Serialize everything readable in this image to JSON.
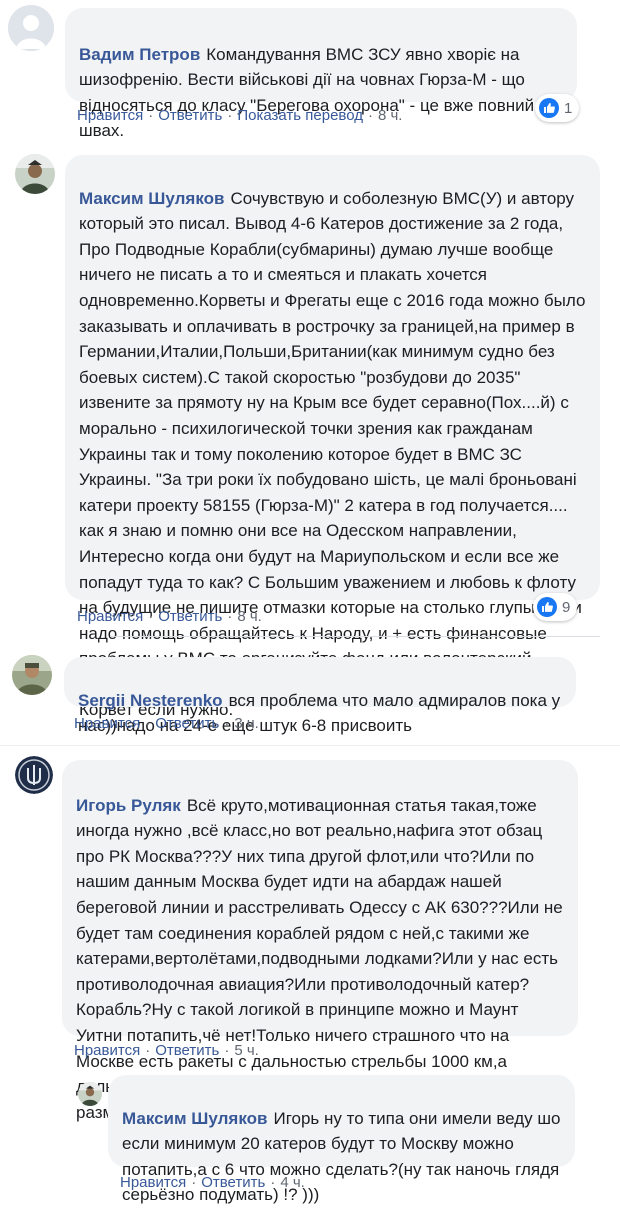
{
  "actions": {
    "like": "Нравится",
    "reply": "Ответить",
    "translate": "Показать перевод",
    "separator": "·"
  },
  "comments": [
    {
      "author": "Вадим Петров",
      "text": "Командування ВМС ЗСУ явно хворіє на шизофренію. Вести військові дії на човнах Гюрза-М - що відносяться до класу \"Берегова охорона\" - це вже повний швах.",
      "time": "8 ч.",
      "reactions": "1"
    },
    {
      "author": "Максим Шуляков",
      "text": "Сочувствую и соболезную ВМС(У) и автору который это писал. Вывод 4-6 Катеров достижение за 2 года, Про Подводные Корабли(субмарины) думаю лучше вообще ничего не писать а то и смеяться и плакать хочется одновременно.Корветы и Фрегаты еще с 2016 года можно было заказывать и оплачивать в рострочку за границей,на пример в Германии,Италии,Польши,Британии(как минимум судно без боевых систем).С такой скоростью \"розбудови до 2035\" извените за прямоту ну на Крым все будет серавно(Пох....й) с морально - психилогической точки зрения как гражданам Украины так и тому поколению которое будет в ВМС ЗС Украины. \"За три роки їх побудовано шість, це малі броньовані катери проекту 58155 (Гюрза-М)\" 2 катера в год получается.... как я знаю и помню они все на Одесском направлении, Интересно когда они будут на Мариупольском и если все же попадут туда то как? С Большим уважением и любовь к флоту на будущие не пишите отмазки которые на столько глупы, если надо помощь обращайтесь к Народу, и + есть финансовые проблемы у ВМС то организуйте фонд или волонтерский сбор(как называтся будет людям пофиг) вам помогут да же на Корвет если нужно.",
      "time": "8 ч.",
      "reactions": "9"
    },
    {
      "author": "Sergii Nesterenko",
      "text": "вся проблема что мало адмиралов пока у нас))надо на 24-е еще штук 6-8 присвоить",
      "time": "3 ч."
    },
    {
      "author": "Игорь Руляк",
      "text": "Всё круто,мотивационная статья такая,тоже иногда нужно ,всё класс,но вот реально,нафига этот обзац про РК Москва???У них типа другой флот,или что?Или по нашим данным Москва будет идти на абардаж нашей береговой линии и расстреливать Одессу с АК 630???Или не будет там соединения кораблей рядом с ней,с такими же катерами,вертолётами,подводными лодками?Или у нас есть противолодочная авиация?Или противолодочный катер? Корабль?Ну с такой логикой в принципе можно и Маунт Уитни потапить,чё нет!Только ничего страшного что на Москве есть ракеты с дальностью стрельбы 1000 км,а дальность хода Гюрзы 900 км,ну это так просто для размышлений)",
      "time": "5 ч."
    },
    {
      "author": "Максим Шуляков",
      "text": "Игорь ну то типа они имели веду шо если минимум 20 катеров будут то Москву можно потапить,а с 6 что можно сделать?(ну так наночь глядя серьёзно подумать) !? )))",
      "time": "4 ч."
    }
  ]
}
